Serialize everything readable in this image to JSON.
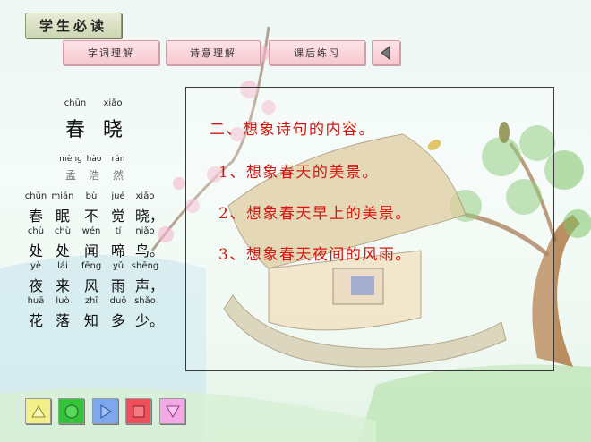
{
  "header": {
    "badge": "学生必读"
  },
  "tabs": [
    {
      "label": "字词理解"
    },
    {
      "label": "诗意理解"
    },
    {
      "label": "课后练习"
    }
  ],
  "back_button": {
    "icon": "triangle-left-icon"
  },
  "poem": {
    "title": {
      "pinyin": [
        "chūn",
        "xiǎo"
      ],
      "chars": [
        "春",
        "晓"
      ]
    },
    "author": {
      "pinyin": [
        "mèng",
        "hào",
        "rán"
      ],
      "chars": [
        "孟",
        "浩",
        "然"
      ]
    },
    "lines": [
      {
        "pinyin": [
          "chūn",
          "mián",
          "bù",
          "jué",
          "xiǎo"
        ],
        "chars": [
          "春",
          "眠",
          "不",
          "觉",
          "晓，"
        ]
      },
      {
        "pinyin": [
          "chù",
          "chù",
          "wén",
          "tí",
          "niǎo"
        ],
        "chars": [
          "处",
          "处",
          "闻",
          "啼",
          "鸟。"
        ]
      },
      {
        "pinyin": [
          "yè",
          "lái",
          "fēng",
          "yǔ",
          "shēng"
        ],
        "chars": [
          "夜",
          "来",
          "风",
          "雨",
          "声，"
        ]
      },
      {
        "pinyin": [
          "huā",
          "luò",
          "zhī",
          "duō",
          "shǎo"
        ],
        "chars": [
          "花",
          "落",
          "知",
          "多",
          "少。"
        ]
      }
    ]
  },
  "panel": {
    "heading": "二、想象诗句的内容。",
    "items": [
      "1、想象春天的美景。",
      "2、想象春天早上的美景。",
      "3、想象春天夜间的风雨。"
    ],
    "text_color": "#d8150f"
  },
  "bottom_buttons": [
    {
      "icon": "triangle-up-icon",
      "color": "#f3f08a"
    },
    {
      "icon": "circle-icon",
      "color": "#35c13a"
    },
    {
      "icon": "play-icon",
      "color": "#7ea8ee"
    },
    {
      "icon": "stop-icon",
      "color": "#ee4f5a"
    },
    {
      "icon": "triangle-down-icon",
      "color": "#f2a9e6"
    }
  ]
}
